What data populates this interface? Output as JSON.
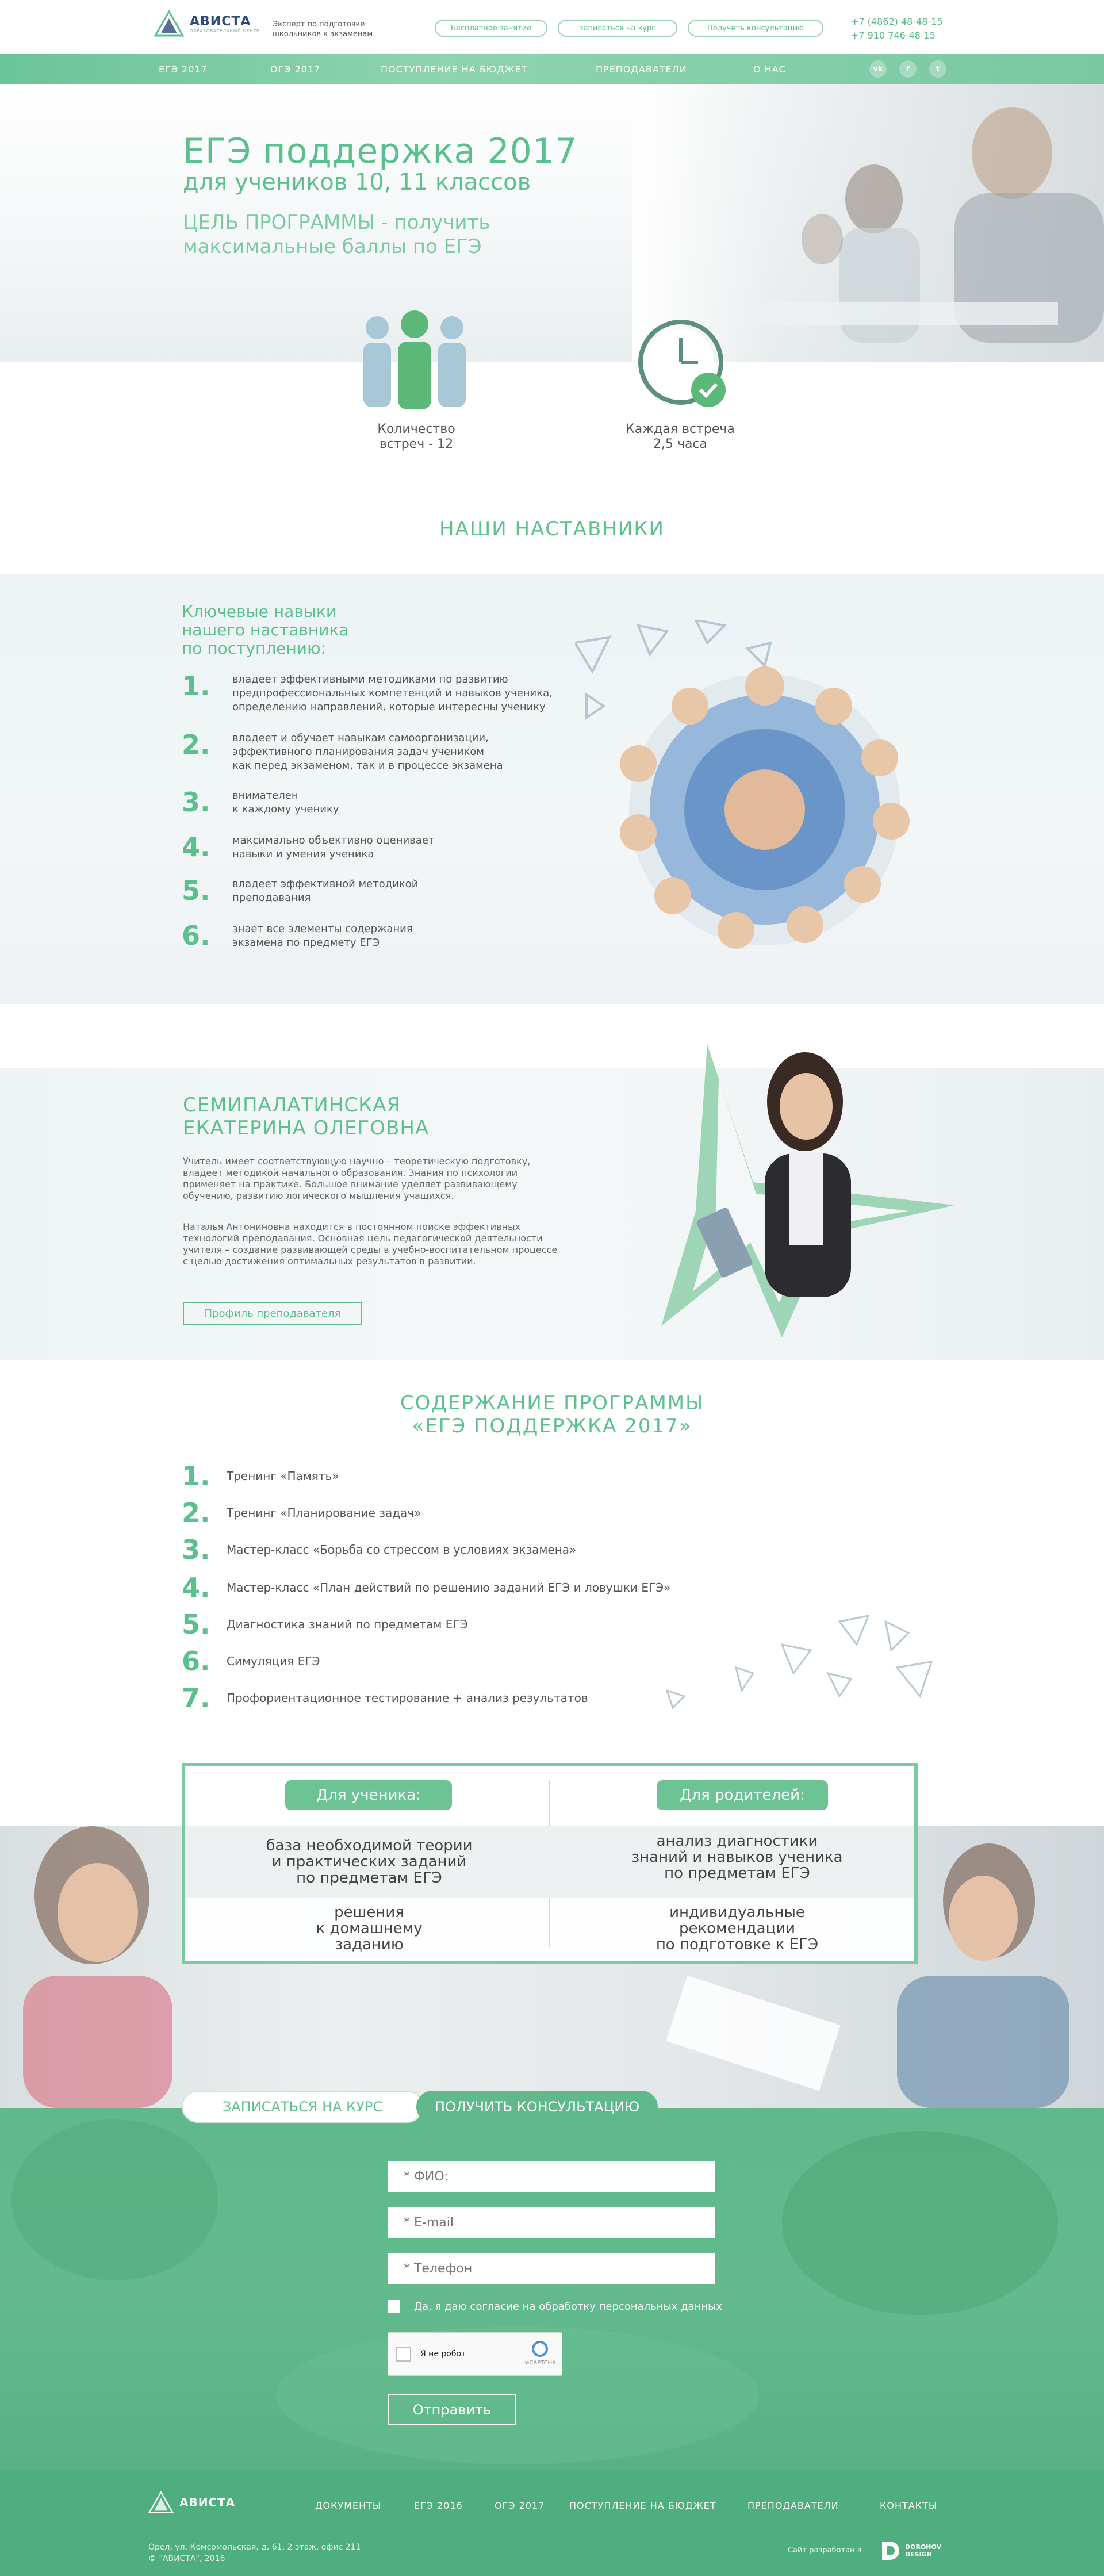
{
  "brand": {
    "name": "АВИСТА",
    "sub": "ОБРАЗОВАТЕЛЬНЫЙ ЦЕНТР",
    "tagline_1": "Эксперт по подготовке",
    "tagline_2": "школьников к экзаменам"
  },
  "header": {
    "buttons": [
      "Бесплатное занятие",
      "записаться на курс",
      "Получить консультацию"
    ],
    "phone_1": "+7 (4862) 48-48-15",
    "phone_2": "+7 910 746-48-15"
  },
  "nav": {
    "items": [
      "ЕГЭ 2017",
      "ОГЭ 2017",
      "ПОСТУПЛЕНИЕ НА БЮДЖЕТ",
      "ПРЕПОДАВАТЕЛИ",
      "О НАС"
    ],
    "social": [
      "vk",
      "f",
      "t"
    ]
  },
  "hero": {
    "title": "ЕГЭ поддержка 2017",
    "subtitle": "для учеников 10, 11 классов",
    "goal_1": "ЦЕЛЬ ПРОГРАММЫ - получить",
    "goal_2": "максимальные баллы по ЕГЭ"
  },
  "stats": {
    "meetings_1": "Количество",
    "meetings_2": "встреч - 12",
    "duration_1": "Каждая встреча",
    "duration_2": "2,5 часа"
  },
  "mentors": {
    "title": "НАШИ НАСТАВНИКИ",
    "head_1": "Ключевые навыки",
    "head_2": "нашего наставника",
    "head_3": "по поступлению:",
    "skills": [
      {
        "num": "1.",
        "l1": "владеет эффективными методиками по развитию",
        "l2": "предпрофессиональных компетенций и навыков ученика,",
        "l3": "определению направлений, которые интересны ученику"
      },
      {
        "num": "2.",
        "l1": "владеет и обучает навыкам самоорганизации,",
        "l2": "эффективного планирования задач учеником",
        "l3": "как перед экзаменом, так и в процессе экзамена"
      },
      {
        "num": "3.",
        "l1": "внимателен",
        "l2": "к каждому ученику",
        "l3": ""
      },
      {
        "num": "4.",
        "l1": "максимально объективно оценивает",
        "l2": "навыки и умения ученика",
        "l3": ""
      },
      {
        "num": "5.",
        "l1": "владеет эффективной методикой",
        "l2": "преподавания",
        "l3": ""
      },
      {
        "num": "6.",
        "l1": "знает все элементы содержания",
        "l2": "экзамена по предмету ЕГЭ",
        "l3": ""
      }
    ]
  },
  "teacher": {
    "name_1": "СЕМИПАЛАТИНСКАЯ",
    "name_2": "ЕКАТЕРИНА ОЛЕГОВНА",
    "p1": [
      "Учитель имеет соответствующую научно – теоретическую подготовку,",
      "владеет методикой начального образования. Знания по психологии",
      "применяет на практике. Большое внимание уделяет развивающему",
      "обучению, развитию логического мышления учащихся."
    ],
    "p2": [
      "Наталья Антониновна находится в постоянном поиске эффективных",
      "технологий преподавания. Основная цель педагогической деятельности",
      "учителя – создание развивающей среды в учебно-воспитательном процессе",
      "с целью достижения оптимальных результатов в развитии."
    ],
    "button": "Профиль преподавателя"
  },
  "program": {
    "title_1": "СОДЕРЖАНИЕ ПРОГРАММЫ",
    "title_2": "«ЕГЭ ПОДДЕРЖКА 2017»",
    "items": [
      {
        "num": "1.",
        "text": "Тренинг «Память»"
      },
      {
        "num": "2.",
        "text": "Тренинг «Планирование задач»"
      },
      {
        "num": "3.",
        "text": "Мастер-класс «Борьба со стрессом в условиях экзамена»"
      },
      {
        "num": "4.",
        "text": "Мастер-класс «План действий по решению заданий ЕГЭ и ловушки ЕГЭ»"
      },
      {
        "num": "5.",
        "text": "Диагностика знаний по предметам ЕГЭ"
      },
      {
        "num": "6.",
        "text": "Симуляция ЕГЭ"
      },
      {
        "num": "7.",
        "text": "Профориентационное тестирование + анализ результатов"
      }
    ]
  },
  "compare": {
    "student": "Для ученика:",
    "parents": "Для родителей:",
    "s1": [
      "база необходимой теории",
      "и практических заданий",
      "по предметам ЕГЭ"
    ],
    "s2": [
      "решения",
      "к домашнему",
      "заданию"
    ],
    "p1": [
      "анализ диагностики",
      "знаний и навыков ученика",
      "по предметам ЕГЭ"
    ],
    "p2": [
      "индивидуальные",
      "рекомендации",
      "по подготовке к ЕГЭ"
    ]
  },
  "form": {
    "tab_signup": "ЗАПИСАТЬСЯ НА КУРС",
    "tab_consult": "ПОЛУЧИТЬ КОНСУЛЬТАЦИЮ",
    "fio": "* ФИО:",
    "email": "* E-mail",
    "phone": "* Телефон",
    "consent": "Да, я даю согласие на обработку персональных данных",
    "captcha": "Я не робот",
    "captcha_brand": "reCAPTCHA",
    "submit": "Отправить"
  },
  "footer": {
    "links": [
      "ДОКУМЕНТЫ",
      "ЕГЭ 2016",
      "ОГЭ 2017",
      "ПОСТУПЛЕНИЕ НА БЮДЖЕТ",
      "ПРЕПОДАВАТЕЛИ",
      "КОНТАКТЫ"
    ],
    "addr_1": "Орел, ул. Комсомольская, д. 61, 2 этаж, офис 211",
    "addr_2": "© \"АВИСТА\", 2016",
    "dev": "Сайт разработан в",
    "dev_name_1": "DOROHOV",
    "dev_name_2": "DESIGN"
  },
  "colors": {
    "accent": "#5cc08e",
    "nav": "#79c8a3",
    "form": "#5fb98a",
    "text": "#4a5560"
  }
}
